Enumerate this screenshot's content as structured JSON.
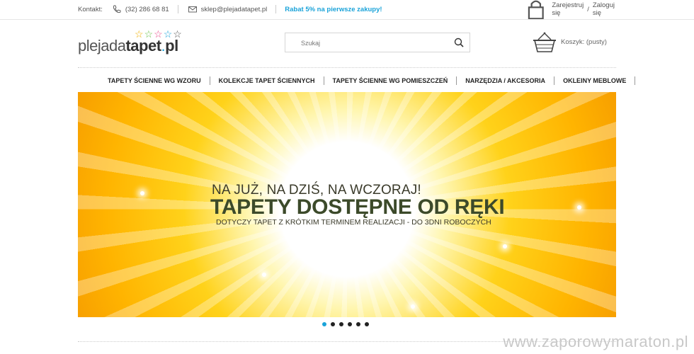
{
  "topbar": {
    "contact_label": "Kontakt:",
    "phone": "(32) 286 68 81",
    "email": "sklep@plejadatapet.pl",
    "promo": "Rabat 5% na pierwsze zakupy!",
    "register": "Zarejestruj się",
    "slash": "/",
    "login": "Zaloguj się"
  },
  "logo": {
    "light": "plejada",
    "bold": "tapet",
    "dot": ".",
    "tld": "pl"
  },
  "search": {
    "placeholder": "Szukaj"
  },
  "cart": {
    "label": "Koszyk: (pusty)"
  },
  "nav": [
    "TAPETY ŚCIENNE WG WZORU",
    "KOLEKCJE TAPET ŚCIENNYCH",
    "TAPETY ŚCIENNE WG POMIESZCZEŃ",
    "NARZĘDZIA / AKCESORIA",
    "OKLEINY MEBLOWE"
  ],
  "banner": {
    "line1": "NA JUŻ, NA DZIŚ, NA WCZORAJ!",
    "line2": "TAPETY DOSTĘPNE OD RĘKI",
    "line3": "DOTYCZY TAPET Z KRÓTKIM TERMINEM REALIZACJI - DO 3DNI ROBOCZYCH"
  },
  "slider": {
    "count": 6,
    "active": 0
  },
  "colors": {
    "accent": "#1aa3d9",
    "banner": "#ffc107"
  },
  "watermark": "www.zaporowymaraton.pl"
}
